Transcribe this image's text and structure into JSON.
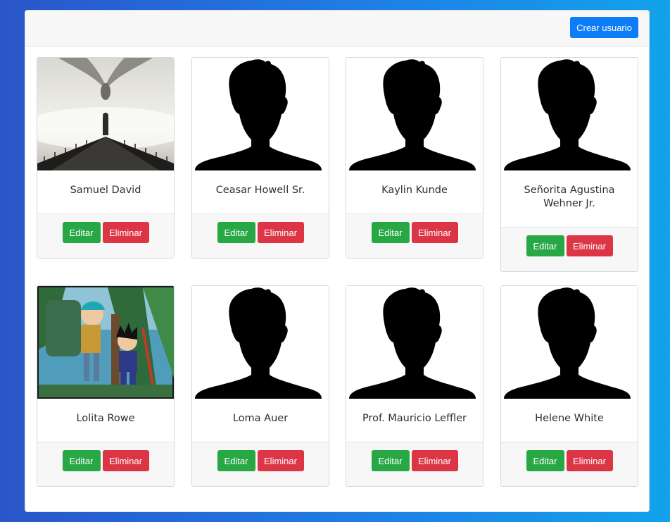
{
  "header": {
    "create_label": "Crear usuario"
  },
  "actions": {
    "edit_label": "Editar",
    "delete_label": "Eliminar"
  },
  "users": [
    {
      "name": "Samuel David",
      "image": "dragon-bridge-photo"
    },
    {
      "name": "Ceasar Howell Sr.",
      "image": "default-silhouette"
    },
    {
      "name": "Kaylin Kunde",
      "image": "default-silhouette"
    },
    {
      "name": "Señorita Agustina Wehner Jr.",
      "image": "default-silhouette"
    },
    {
      "name": "Lolita Rowe",
      "image": "anime-forest-illustration"
    },
    {
      "name": "Loma Auer",
      "image": "default-silhouette"
    },
    {
      "name": "Prof. Mauricio Leffler",
      "image": "default-silhouette"
    },
    {
      "name": "Helene White",
      "image": "default-silhouette"
    }
  ],
  "colors": {
    "primary": "#0d7cf7",
    "success": "#28a745",
    "danger": "#dc3545"
  }
}
